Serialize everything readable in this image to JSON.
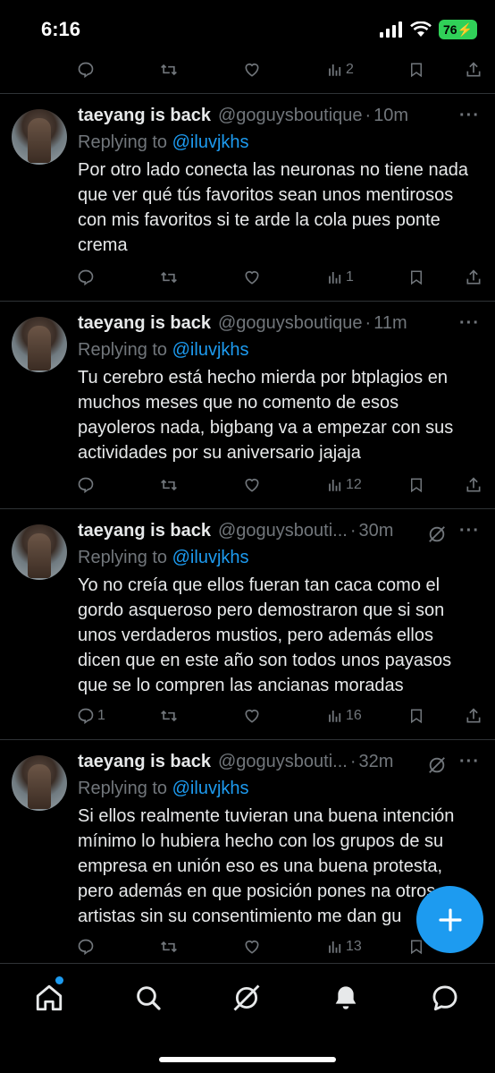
{
  "status_bar": {
    "time": "6:16",
    "battery": "76"
  },
  "top_actions": {
    "replies": "",
    "reposts": "",
    "likes": "",
    "views": "2"
  },
  "tweets": [
    {
      "name": "taeyang is back",
      "handle": "@goguysboutique",
      "time": "10m",
      "replying_prefix": "Replying to ",
      "replying_to": "@iluvjkhs",
      "text": "Por otro lado conecta las neuronas no tiene nada que ver qué tús favoritos sean unos mentirosos con mis favoritos si te arde la cola pues ponte crema",
      "replies": "",
      "views": "1"
    },
    {
      "name": "taeyang is back",
      "handle": "@goguysboutique",
      "time": "11m",
      "replying_prefix": "Replying to ",
      "replying_to": "@iluvjkhs",
      "text": "Tu cerebro está hecho mierda por btplagios  en muchos meses que no comento de esos payoleros nada, bigbang va a empezar con sus actividades por su aniversario jajaja",
      "replies": "",
      "views": "12"
    },
    {
      "name": "taeyang is back",
      "handle": "@goguysbouti...",
      "time": "30m",
      "replying_prefix": "Replying to ",
      "replying_to": "@iluvjkhs",
      "text": "Yo no creía que ellos fueran tan caca como el gordo asqueroso pero demostraron que si son unos verdaderos mustios, pero además ellos dicen que en este año son todos unos payasos que se lo compren las ancianas moradas",
      "replies": "1",
      "views": "16"
    },
    {
      "name": "taeyang is back",
      "handle": "@goguysbouti...",
      "time": "32m",
      "replying_prefix": "Replying to ",
      "replying_to": "@iluvjkhs",
      "text": "Si ellos realmente tuvieran una buena intención mínimo lo hubiera hecho con los grupos de su empresa en unión eso es una buena protesta, pero además en que posición pones na otros artistas sin su consentimiento me dan gu",
      "replies": "",
      "views": "13"
    }
  ],
  "colors": {
    "accent": "#1d9bf0",
    "muted": "#71767b",
    "text": "#e7e9ea",
    "divider": "#2f3336",
    "battery": "#30d158"
  },
  "nav": [
    "home-icon",
    "search-icon",
    "grok-icon",
    "notifications-icon",
    "messages-icon"
  ]
}
